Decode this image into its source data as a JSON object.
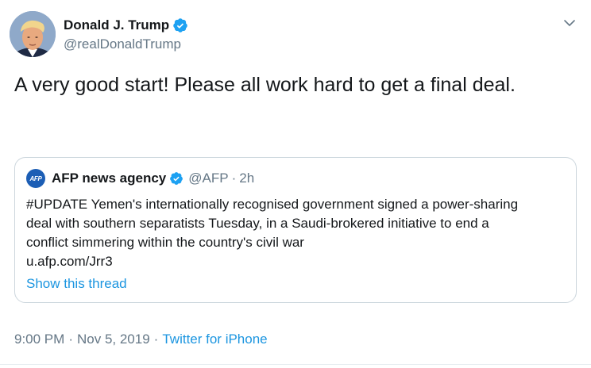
{
  "author": {
    "name": "Donald J. Trump",
    "handle": "@realDonaldTrump",
    "verified_icon": "verified-badge-icon",
    "verified_color": "#1da1f2"
  },
  "tweet": {
    "text": "A very good start! Please all work hard to get a final deal."
  },
  "quoted_tweet": {
    "avatar_text": "AFP",
    "name": "AFP news agency",
    "handle": "@AFP",
    "separator": "·",
    "time": "2h",
    "text_lines": [
      "#UPDATE Yemen's internationally recognised government signed a power-sharing",
      "deal with southern separatists Tuesday, in a Saudi-brokered initiative to end a",
      "conflict simmering within the country's civil war",
      "u.afp.com/Jrr3"
    ],
    "show_thread": "Show this thread"
  },
  "meta": {
    "time": "9:00 PM",
    "dot1": "·",
    "date": "Nov 5, 2019",
    "dot2": "·",
    "source": "Twitter for iPhone"
  },
  "colors": {
    "link": "#1b95e0",
    "secondary_text": "#657786",
    "border": "#ccd6dd"
  }
}
